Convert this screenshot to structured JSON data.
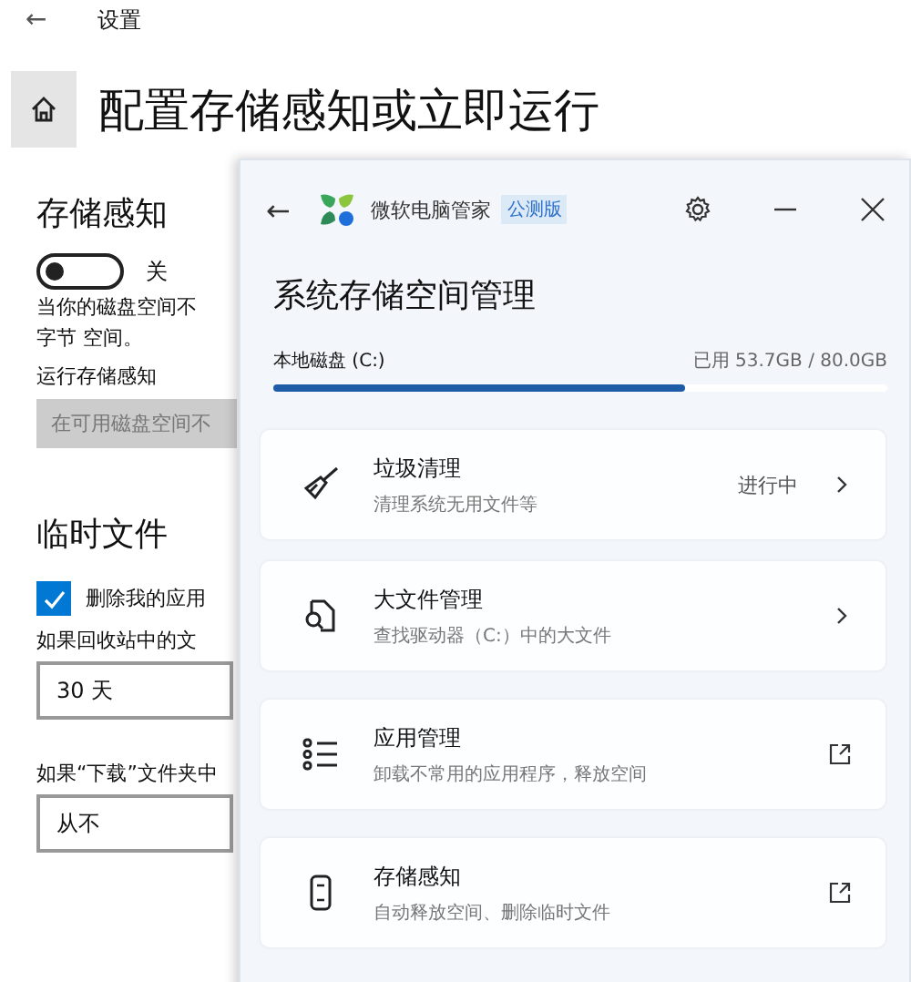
{
  "settings": {
    "back": "←",
    "title": "设置",
    "heading": "配置存储感知或立即运行",
    "storage_sense": {
      "title": "存储感知",
      "toggle_label": "关",
      "on": false,
      "description": "当你的磁盘空间不",
      "description_2": "字节 空间。",
      "run_label": "运行存储感知",
      "run_value": "在可用磁盘空间不"
    },
    "temp_files": {
      "title": "临时文件",
      "checkbox_label": "删除我的应用",
      "checked": true,
      "fields": [
        {
          "label": "如果回收站中的文",
          "value": "30 天"
        },
        {
          "label": "如果“下载”文件夹中",
          "value": "从不"
        }
      ]
    }
  },
  "app": {
    "back": "←",
    "name": "微软电脑管家",
    "badge": "公测版",
    "title": "系统存储空间管理",
    "disk": {
      "label": "本地磁盘 (C:)",
      "usage": "已用 53.7GB / 80.0GB",
      "level": 0.67
    },
    "cards": [
      {
        "kind": "broom",
        "title": "垃圾清理",
        "subtitle": "清理系统无用文件等",
        "status": "进行中",
        "external_link": false
      },
      {
        "kind": "search-file",
        "title": "大文件管理",
        "subtitle": "查找驱动器（C:）中的大文件",
        "external_link": false
      },
      {
        "kind": "list",
        "title": "应用管理",
        "subtitle": "卸载不常用的应用程序，释放空间",
        "external_link": true
      },
      {
        "kind": "phone",
        "title": "存储感知",
        "subtitle": "自动释放空间、删除临时文件",
        "external_link": true
      }
    ]
  }
}
